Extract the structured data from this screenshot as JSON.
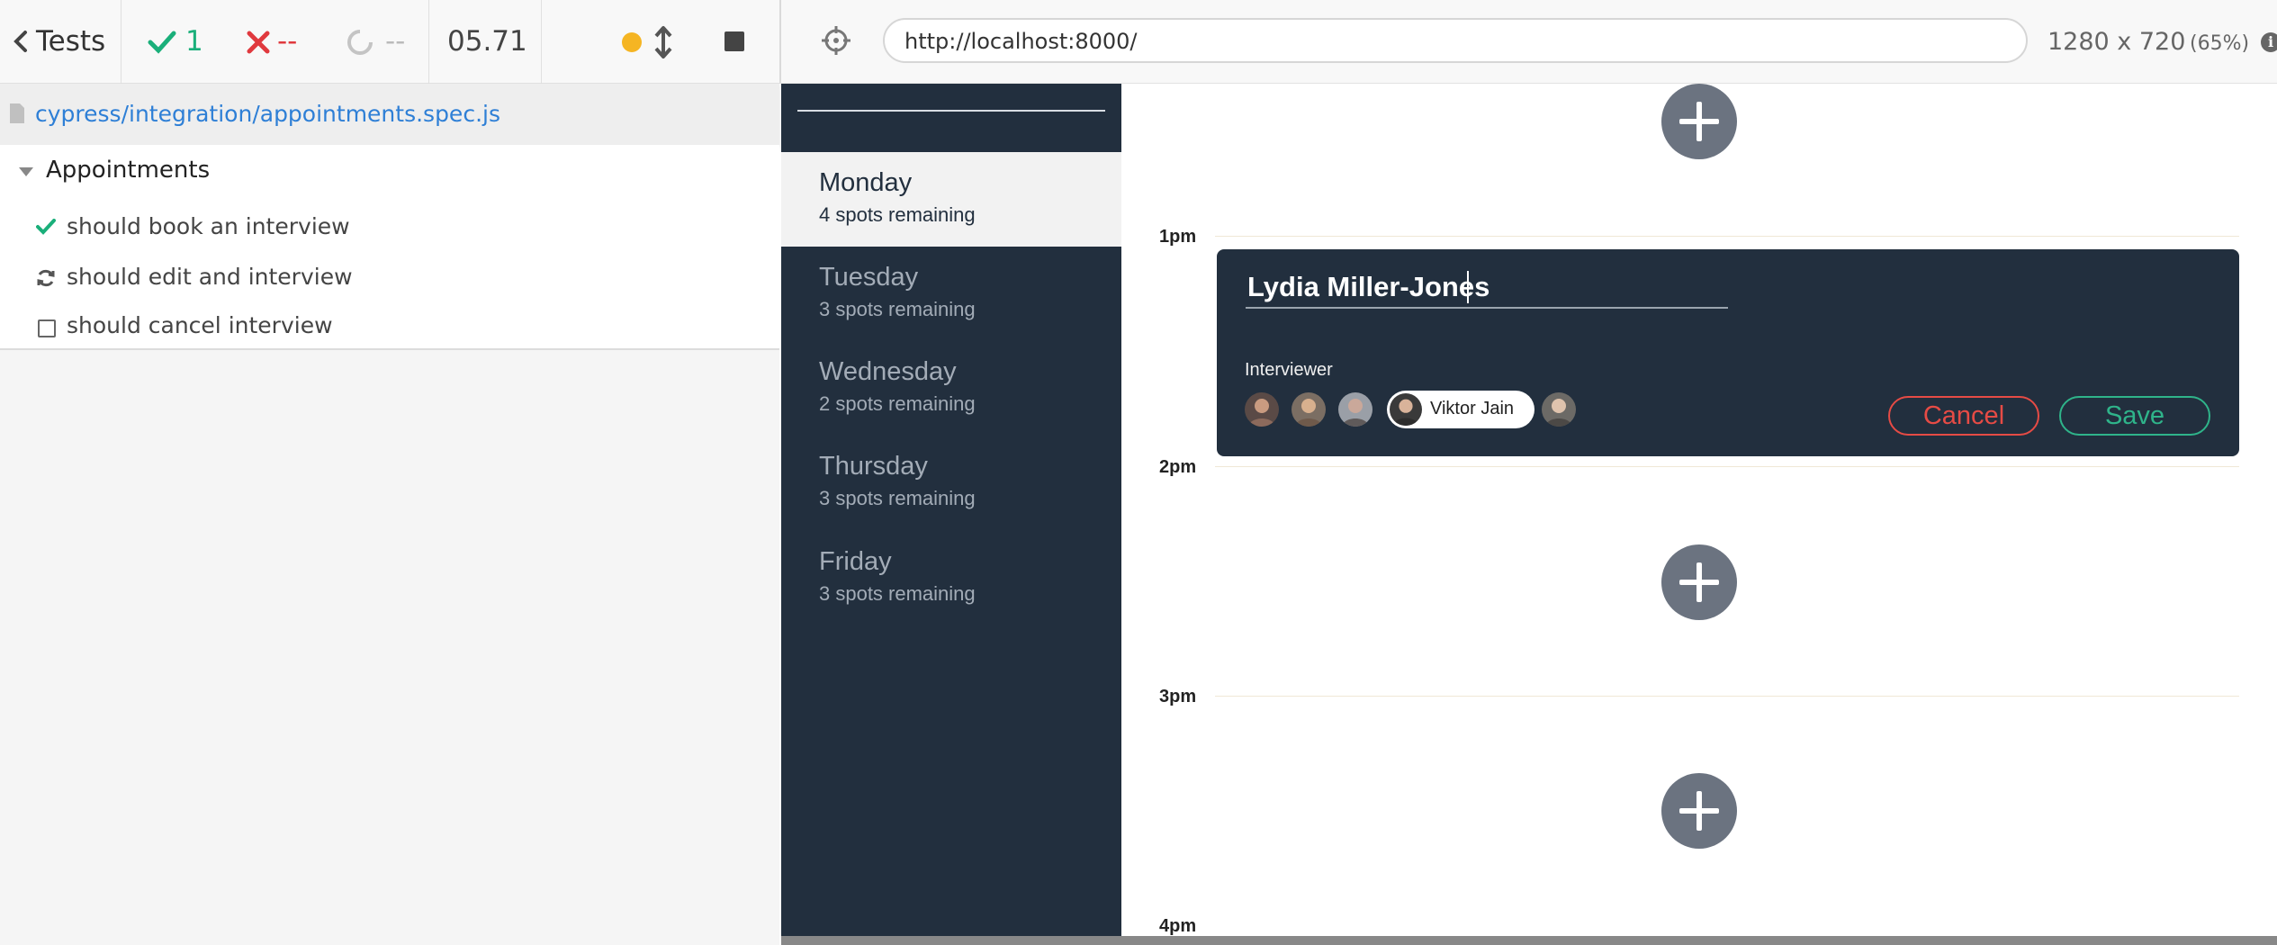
{
  "runner": {
    "tests_label": "Tests",
    "passed_count": "1",
    "failed_count": "--",
    "pending_count": "--",
    "duration": "05.71",
    "spec_file": "cypress/integration/appointments.spec.js",
    "suite_title": "Appointments",
    "tests": [
      {
        "label": "should book an interview",
        "state": "passed"
      },
      {
        "label": "should edit and interview",
        "state": "running"
      },
      {
        "label": "should cancel interview",
        "state": "pending"
      }
    ]
  },
  "browser": {
    "url": "http://localhost:8000/",
    "viewport": "1280 x 720",
    "scale": "(65%)"
  },
  "sidebar": {
    "days": [
      {
        "name": "Monday",
        "spots": "4 spots remaining",
        "selected": true
      },
      {
        "name": "Tuesday",
        "spots": "3 spots remaining",
        "selected": false
      },
      {
        "name": "Wednesday",
        "spots": "2 spots remaining",
        "selected": false
      },
      {
        "name": "Thursday",
        "spots": "3 spots remaining",
        "selected": false
      },
      {
        "name": "Friday",
        "spots": "3 spots remaining",
        "selected": false
      }
    ]
  },
  "schedule": {
    "times": [
      "1pm",
      "2pm",
      "3pm",
      "4pm"
    ],
    "form": {
      "student_name": "Lydia Miller-Jones",
      "interviewer_label": "Interviewer",
      "selected_interviewer": "Viktor Jain",
      "cancel_label": "Cancel",
      "save_label": "Save"
    }
  },
  "colors": {
    "pass": "#1aaf7a",
    "fail": "#e0393e",
    "link": "#2e7fd6",
    "app_dark": "#222f3e",
    "cancel": "#e64b45",
    "save": "#2fb48a"
  }
}
